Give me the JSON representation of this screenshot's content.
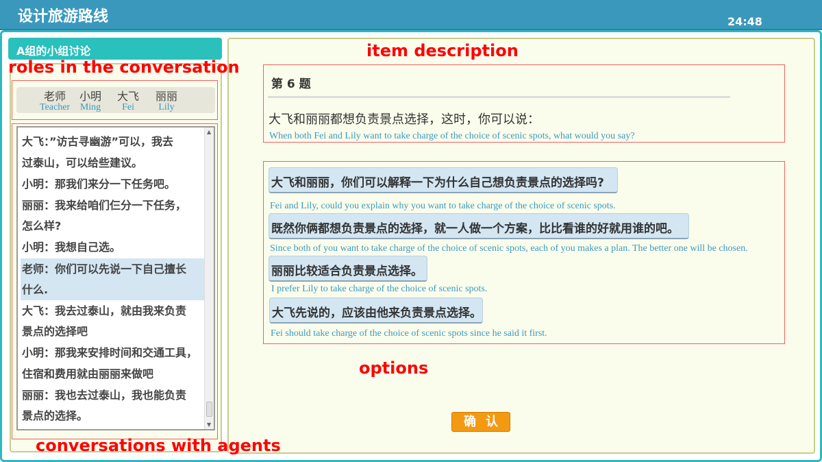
{
  "header": {
    "title": "设计旅游路线",
    "timer": "24:48"
  },
  "left": {
    "title": "A组的小组讨论",
    "roles": [
      {
        "zh": "老师",
        "en": "Teacher"
      },
      {
        "zh": "小明",
        "en": "Ming"
      },
      {
        "zh": "大飞",
        "en": "Fei"
      },
      {
        "zh": "丽丽",
        "en": "Lily"
      }
    ],
    "chat": [
      "大飞：”访古寻幽游”可以，我去",
      "过泰山，可以给些建议。",
      "小明：那我们来分一下任务吧。",
      "丽丽：我来给咱们仨分一下任务，",
      "怎么样?",
      "小明：我想自己选。",
      "老师：你们可以先说一下自己擅长",
      "什么.",
      "大飞：我去过泰山，就由我来负责",
      "景点的选择吧",
      "小明：那我来安排时间和交通工具，",
      "住宿和费用就由丽丽来做吧",
      "丽丽：我也去过泰山，我也能负责",
      "景点的选择。"
    ]
  },
  "question": {
    "number": "第 6 题",
    "text_zh": "大飞和丽丽都想负责景点选择，这时，你可以说：",
    "text_en": "When both Fei and Lily want to take charge of the choice of scenic spots, what would you say?"
  },
  "options": [
    {
      "zh": "大飞和丽丽，你们可以解释一下为什么自己想负责景点的选择吗?",
      "en": "Fei and Lily, could you explain why you want to take charge of the choice of scenic spots."
    },
    {
      "zh": "既然你俩都想负责景点的选择，就一人做一个方案，比比看谁的好就用谁的吧。",
      "en": "Since both of you want to take charge of the choice of scenic spots, each of you makes a plan. The better one will be chosen."
    },
    {
      "zh": "丽丽比较适合负责景点选择。",
      "en": "I prefer Lily to take charge of the choice of scenic spots."
    },
    {
      "zh": "大飞先说的，应该由他来负责景点选择。",
      "en": "Fei should take charge of the choice of scenic spots since he said it first."
    }
  ],
  "confirm_label": "确认",
  "annotations": {
    "roles": "roles in the conversation",
    "conversations": "conversations with agents",
    "item": "item description",
    "options": "options"
  }
}
